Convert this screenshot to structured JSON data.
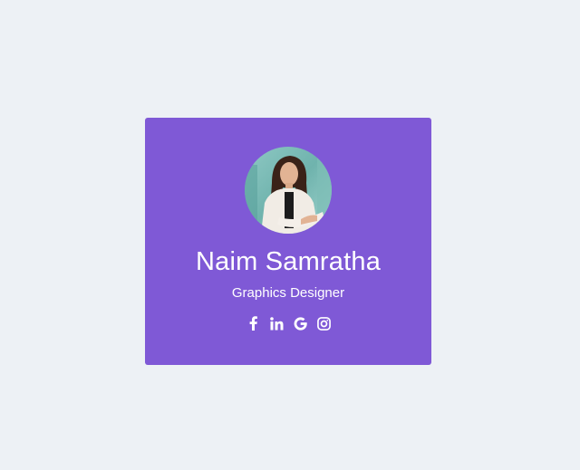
{
  "card": {
    "name": "Naim Samratha",
    "role": "Graphics Designer",
    "background": "#7f59d6",
    "text_color": "#ffffff",
    "socials": [
      {
        "icon": "facebook-icon"
      },
      {
        "icon": "linkedin-icon"
      },
      {
        "icon": "google-icon"
      },
      {
        "icon": "instagram-icon"
      }
    ]
  },
  "page": {
    "background": "#edf1f5"
  }
}
